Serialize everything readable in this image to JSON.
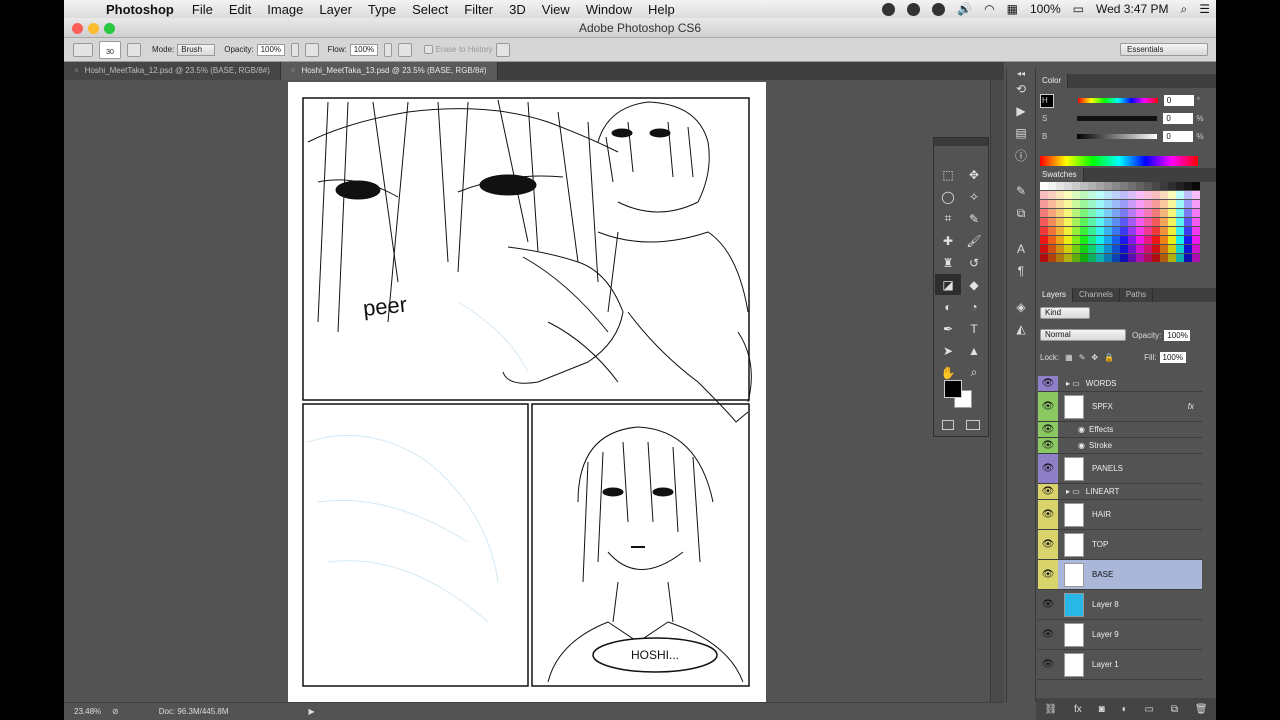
{
  "menubar": {
    "app": "Photoshop",
    "items": [
      "File",
      "Edit",
      "Image",
      "Layer",
      "Type",
      "Select",
      "Filter",
      "3D",
      "View",
      "Window",
      "Help"
    ],
    "battery": "100%",
    "clock": "Wed 3:47 PM"
  },
  "window": {
    "title": "Adobe Photoshop CS6"
  },
  "options": {
    "brush_size": "30",
    "mode_label": "Mode:",
    "mode_value": "Brush",
    "opacity_label": "Opacity:",
    "opacity_value": "100%",
    "flow_label": "Flow:",
    "flow_value": "100%",
    "erase_history": "Erase to History",
    "workspace": "Essentials"
  },
  "tabs": [
    {
      "label": "Hoshi_MeetTaka_12.psd @ 23.5% (BASE, RGB/8#)"
    },
    {
      "label": "Hoshi_MeetTaka_13.psd @ 23.5% (BASE, RGB/8#)"
    }
  ],
  "canvas": {
    "sfx_text": "peer",
    "speech_bubble": "HOSHI..."
  },
  "status": {
    "zoom": "23.48%",
    "doc": "Doc: 96.3M/445.8M"
  },
  "color_panel": {
    "tabs": [
      "Color"
    ],
    "rows": [
      {
        "label": "H",
        "value": "0",
        "unit": "°"
      },
      {
        "label": "S",
        "value": "0",
        "unit": "%"
      },
      {
        "label": "B",
        "value": "0",
        "unit": "%"
      }
    ],
    "fg": "#000000",
    "bg": "#ffffff"
  },
  "swatch_panel": {
    "tabs": [
      "Swatches"
    ]
  },
  "layers_panel": {
    "tabs": [
      "Layers",
      "Channels",
      "Paths"
    ],
    "kind": "Kind",
    "blend": "Normal",
    "opacity_label": "Opacity:",
    "opacity": "100%",
    "lock_label": "Lock:",
    "fill_label": "Fill:",
    "fill": "100%",
    "layers": [
      {
        "name": "WORDS",
        "tag": "#8f7fc7",
        "kind": "group"
      },
      {
        "name": "SPFX",
        "tag": "#8cc862",
        "kind": "layer",
        "fx": "fx"
      },
      {
        "name": "Effects",
        "tag": "#8cc862",
        "kind": "effect"
      },
      {
        "name": "Stroke",
        "tag": "#8cc862",
        "kind": "effect"
      },
      {
        "name": "PANELS",
        "tag": "#8f7fc7",
        "kind": "layer"
      },
      {
        "name": "LINEART",
        "tag": "#d8d36a",
        "kind": "group"
      },
      {
        "name": "HAIR",
        "tag": "#d8d36a",
        "kind": "layer"
      },
      {
        "name": "TOP",
        "tag": "#d8d36a",
        "kind": "layer"
      },
      {
        "name": "BASE",
        "tag": "#d8d36a",
        "kind": "layer",
        "selected": true
      },
      {
        "name": "Layer 8",
        "tag": "",
        "kind": "layer",
        "thumb": "#29b7e8"
      },
      {
        "name": "Layer 9",
        "tag": "",
        "kind": "layer"
      },
      {
        "name": "Layer 1",
        "tag": "",
        "kind": "layer"
      }
    ]
  }
}
